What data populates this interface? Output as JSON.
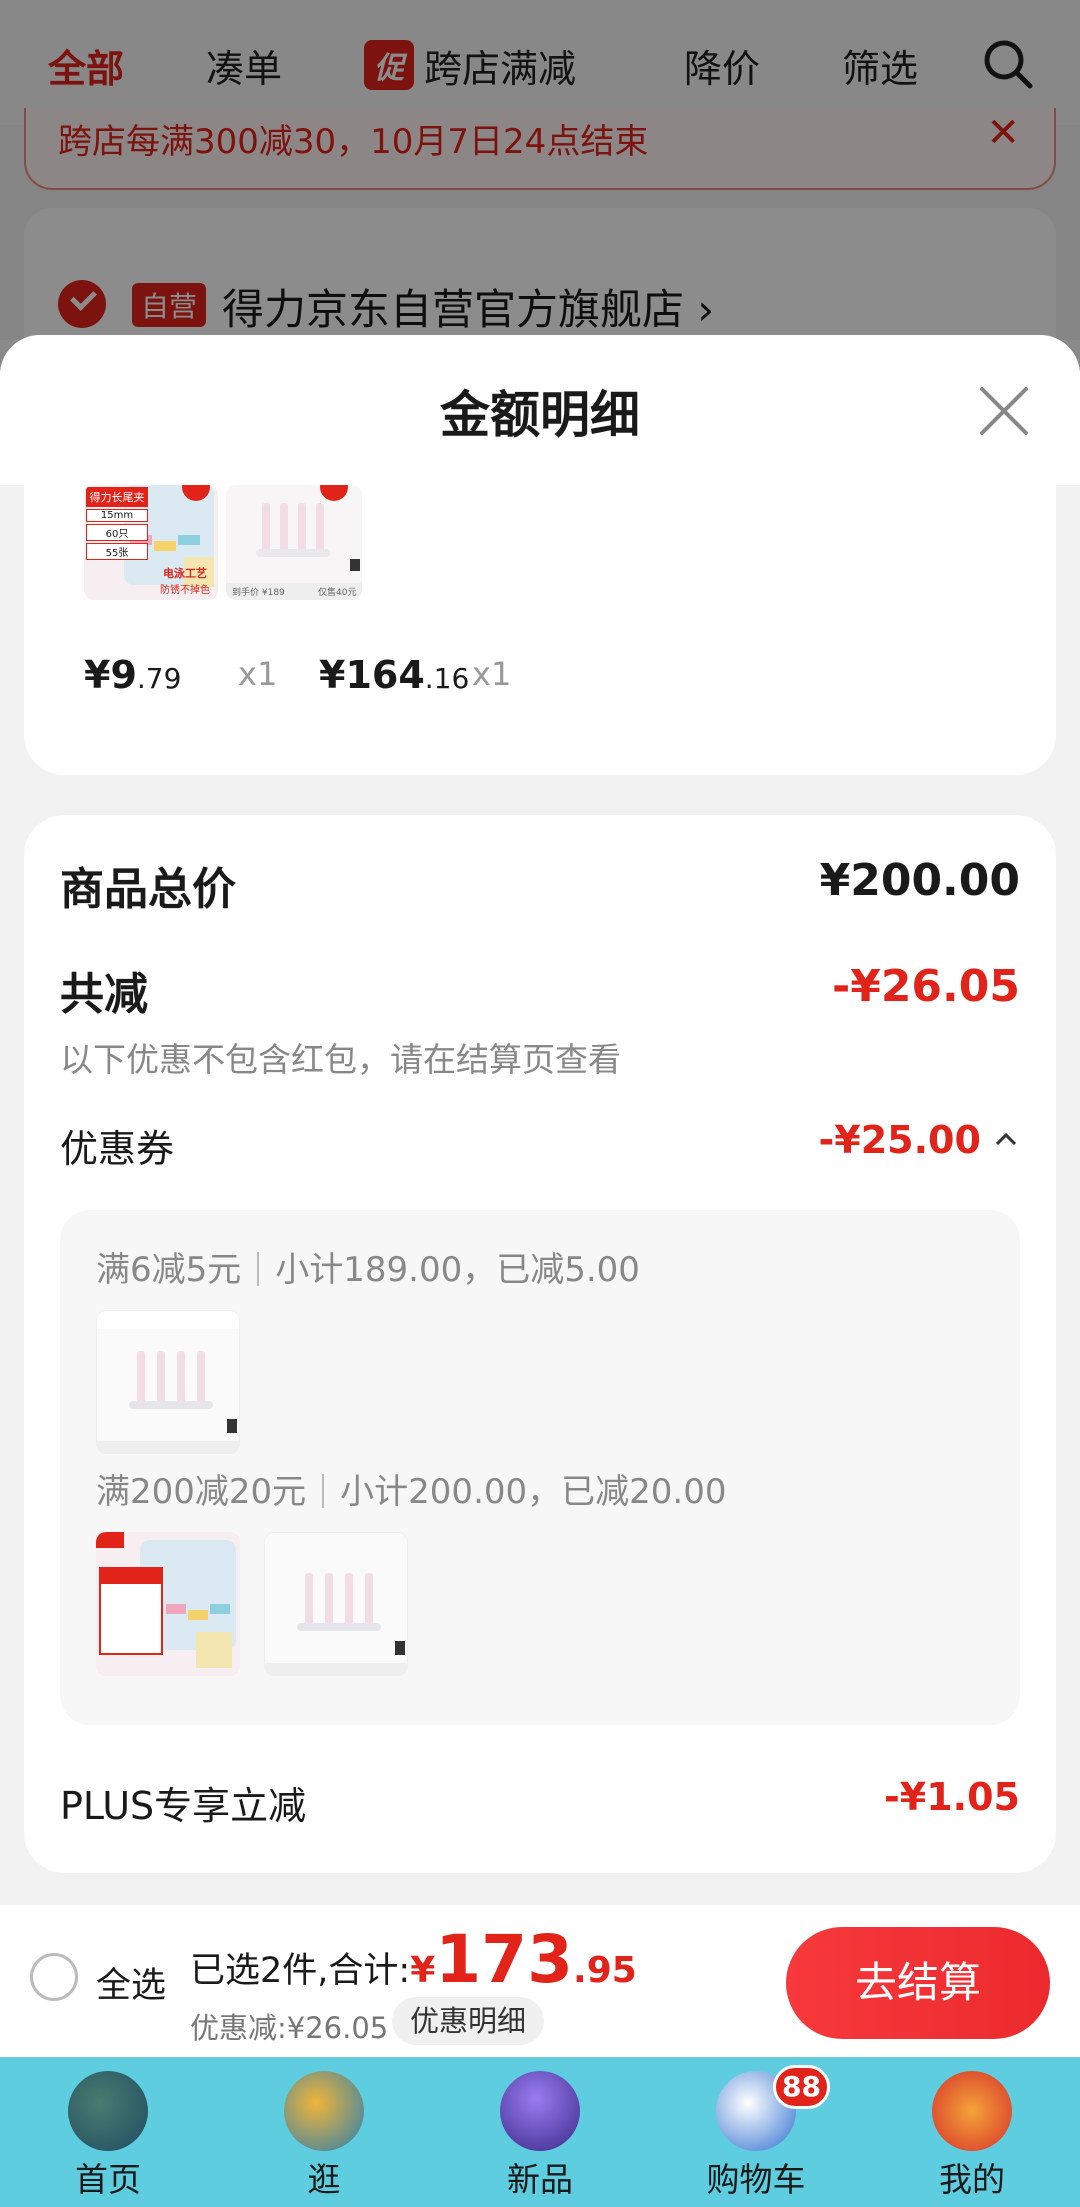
{
  "top_tabs": {
    "all": "全部",
    "bundle": "凑单",
    "promo_tag": "促",
    "cross_store": "跨店满减",
    "price_drop": "降价",
    "filter": "筛选"
  },
  "banner": {
    "text": "跨店每满300减30，10月7日24点结束"
  },
  "store": {
    "tag": "自营",
    "name": "得力京东自营官方旗舰店"
  },
  "sheet": {
    "title": "金额明细",
    "items": [
      {
        "price_int": "¥9",
        "price_dec": ".79",
        "qty": "x1",
        "thumb_text": [
          "得力长尾夹",
          "15mm",
          "60只",
          "55张",
          "电泳工艺",
          "防锈不掉色"
        ]
      },
      {
        "price_int": "¥164",
        "price_dec": ".16",
        "qty": "x1",
        "thumb_text": [
          "到手价 ¥189",
          "仅售40元"
        ]
      }
    ]
  },
  "detail": {
    "total_label": "商品总价",
    "total_value": "¥200.00",
    "reduce_label": "共减",
    "reduce_value": "-¥26.05",
    "note": "以下优惠不包含红包，请在结算页查看",
    "coupon_label": "优惠券",
    "coupon_value": "-¥25.00",
    "coupons": [
      {
        "rule": "满6减5元",
        "summary": "小计189.00，已减5.00"
      },
      {
        "rule": "满200减20元",
        "summary": "小计200.00，已减20.00"
      }
    ],
    "plus_label": "PLUS专享立减",
    "plus_value": "-¥1.05"
  },
  "bottom": {
    "select_all": "全选",
    "selected_prefix": "已选2件,合计:",
    "total_symbol": "¥",
    "total_int": "173",
    "total_dec": ".95",
    "discount_line": "优惠减:¥26.05",
    "discount_btn": "优惠明细",
    "checkout": "去结算"
  },
  "nav": [
    {
      "label": "首页",
      "icon": "home-mascot-icon"
    },
    {
      "label": "逛",
      "icon": "explore-mascot-icon"
    },
    {
      "label": "新品",
      "icon": "new-crystal-icon"
    },
    {
      "label": "购物车",
      "icon": "cart-mascot-icon",
      "badge": "88"
    },
    {
      "label": "我的",
      "icon": "profile-flower-icon"
    }
  ],
  "colors": {
    "accent": "#e2231a",
    "nav_bg": "#5ecddf"
  }
}
